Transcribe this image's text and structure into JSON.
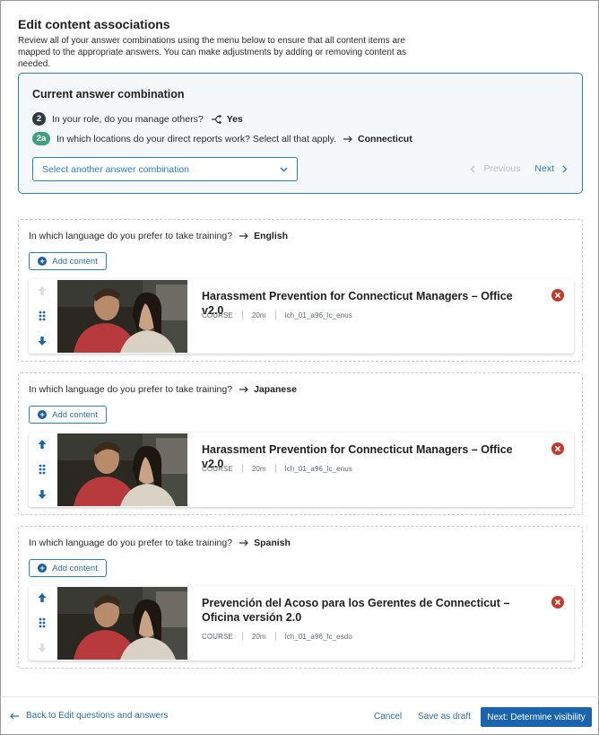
{
  "page": {
    "title": "Edit content associations",
    "description": "Review all of your answer combinations using the menu below to ensure that all content items are mapped to the appropriate answers. You can make adjustments by adding or removing content as needed."
  },
  "combination": {
    "title": "Current answer combination",
    "rows": [
      {
        "badge": "2",
        "question": "In your role, do you manage others?",
        "icon": "branch-icon",
        "answer": "Yes"
      },
      {
        "badge": "2a",
        "question": "In which locations do your direct reports work? Select all that apply.",
        "icon": "arrow-right-icon",
        "answer": "Connecticut"
      }
    ],
    "select_placeholder": "Select another answer combination",
    "prev_label": "Previous",
    "next_label": "Next"
  },
  "sections": [
    {
      "question": "In which language do you prefer to take training?",
      "answer": "English",
      "add_label": "Add content",
      "item": {
        "title": "Harassment Prevention for Connecticut Managers – Office v2.0",
        "type": "COURSE",
        "duration": "20m",
        "code": "lch_01_a96_lc_enus",
        "up_enabled": false,
        "down_enabled": true
      }
    },
    {
      "question": "In which language do you prefer to take training?",
      "answer": "Japanese",
      "add_label": "Add content",
      "item": {
        "title": "Harassment Prevention for Connecticut Managers – Office v2.0",
        "type": "COURSE",
        "duration": "20m",
        "code": "lch_01_a96_lc_enus",
        "up_enabled": true,
        "down_enabled": true
      }
    },
    {
      "question": "In which language do you prefer to take training?",
      "answer": "Spanish",
      "add_label": "Add content",
      "item": {
        "title": "Prevención del Acoso para los Gerentes de Connecticut – Oficina versión 2.0",
        "type": "COURSE",
        "duration": "20m",
        "code": "lch_01_a96_lc_esdo",
        "up_enabled": true,
        "down_enabled": false
      }
    }
  ],
  "footer": {
    "back_label": "Back to Edit questions and answers",
    "cancel_label": "Cancel",
    "draft_label": "Save as draft",
    "next_label": "Next: Determine visibility"
  },
  "colors": {
    "accent": "#2b80b9",
    "primary_button": "#1a63ad",
    "remove": "#c0392b",
    "badge_dark": "#2e3a44",
    "badge_green": "#3fa07a"
  }
}
